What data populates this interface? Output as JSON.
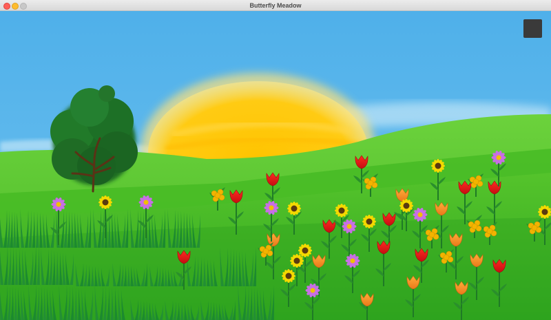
{
  "window": {
    "title": "Butterfly Meadow"
  },
  "scene": {
    "sky_color": "#5cb6ea",
    "sun_color": "#fdc50a",
    "hill_color": "#4fc02a",
    "grass_color": "#1f8a2e",
    "tree_color": "#1e6b24"
  },
  "menu_button": {
    "icon": "square-menu-icon",
    "color": "#3a3a3a"
  },
  "flower_colors": {
    "tulip_red": "#e8161c",
    "tulip_orange": "#f58a1f",
    "sunflower": "#f5d900",
    "daisy": "#c86ee6",
    "buttercup": "#f2b400"
  },
  "flowers": [
    {
      "type": "tulip_red"
    },
    {
      "type": "tulip_red"
    },
    {
      "type": "tulip_red"
    },
    {
      "type": "tulip_red"
    },
    {
      "type": "tulip_red"
    },
    {
      "type": "tulip_red"
    },
    {
      "type": "tulip_red"
    },
    {
      "type": "tulip_red"
    },
    {
      "type": "tulip_red"
    },
    {
      "type": "tulip_red"
    },
    {
      "type": "tulip_red"
    },
    {
      "type": "tulip_orange"
    },
    {
      "type": "tulip_orange"
    },
    {
      "type": "tulip_orange"
    },
    {
      "type": "tulip_orange"
    },
    {
      "type": "tulip_orange"
    },
    {
      "type": "tulip_orange"
    },
    {
      "type": "tulip_orange"
    },
    {
      "type": "tulip_orange"
    },
    {
      "type": "tulip_orange"
    },
    {
      "type": "sunflower"
    },
    {
      "type": "sunflower"
    },
    {
      "type": "sunflower"
    },
    {
      "type": "sunflower"
    },
    {
      "type": "sunflower"
    },
    {
      "type": "sunflower"
    },
    {
      "type": "sunflower"
    },
    {
      "type": "sunflower"
    },
    {
      "type": "sunflower"
    },
    {
      "type": "sunflower"
    },
    {
      "type": "daisy"
    },
    {
      "type": "daisy"
    },
    {
      "type": "daisy"
    },
    {
      "type": "daisy"
    },
    {
      "type": "daisy"
    },
    {
      "type": "daisy"
    },
    {
      "type": "daisy"
    },
    {
      "type": "daisy"
    },
    {
      "type": "buttercup"
    },
    {
      "type": "buttercup"
    },
    {
      "type": "buttercup"
    },
    {
      "type": "buttercup"
    },
    {
      "type": "buttercup"
    },
    {
      "type": "buttercup"
    },
    {
      "type": "buttercup"
    },
    {
      "type": "buttercup"
    },
    {
      "type": "buttercup"
    }
  ]
}
